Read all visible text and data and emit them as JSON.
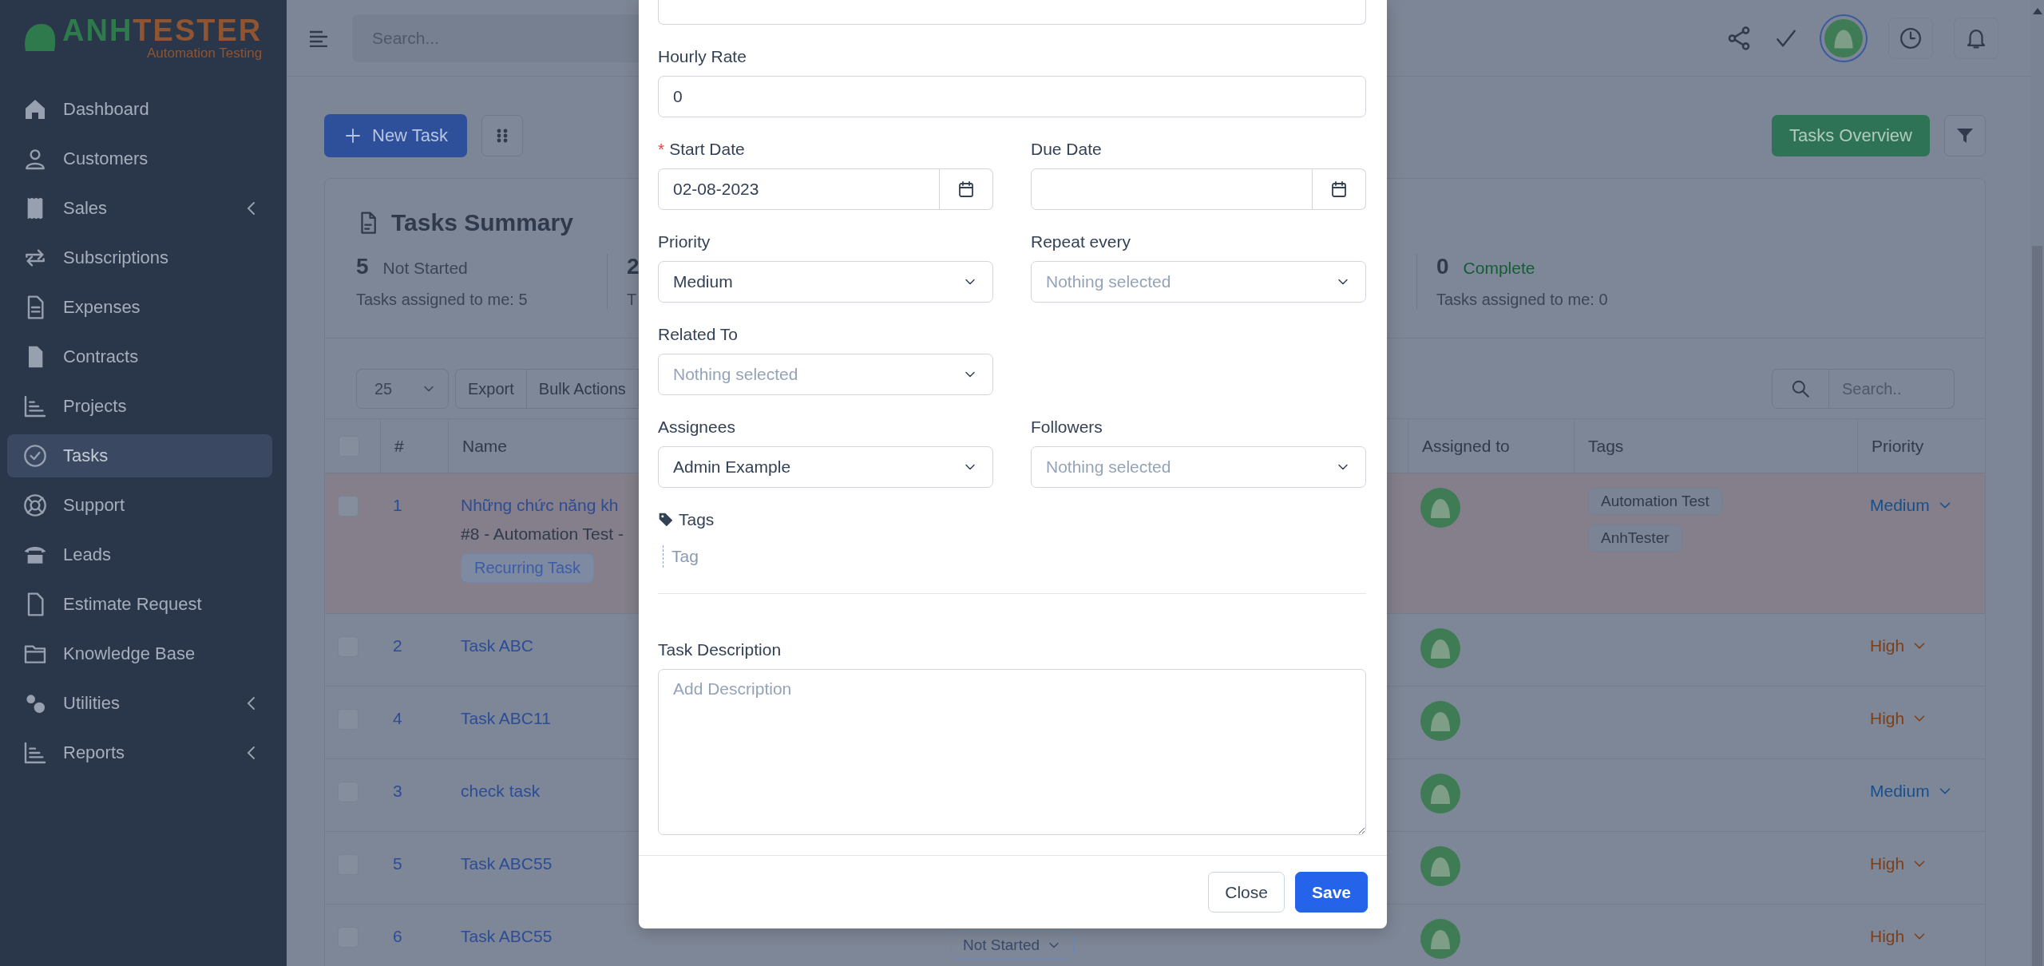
{
  "logo": {
    "name_start": "ANH",
    "name_end": "TESTER",
    "tagline": "Automation Testing"
  },
  "sidebar": {
    "items": [
      {
        "label": "Dashboard",
        "selected": false,
        "has_submenu": false
      },
      {
        "label": "Customers",
        "selected": false,
        "has_submenu": false
      },
      {
        "label": "Sales",
        "selected": false,
        "has_submenu": true
      },
      {
        "label": "Subscriptions",
        "selected": false,
        "has_submenu": false
      },
      {
        "label": "Expenses",
        "selected": false,
        "has_submenu": false
      },
      {
        "label": "Contracts",
        "selected": false,
        "has_submenu": false
      },
      {
        "label": "Projects",
        "selected": false,
        "has_submenu": false
      },
      {
        "label": "Tasks",
        "selected": true,
        "has_submenu": false
      },
      {
        "label": "Support",
        "selected": false,
        "has_submenu": false
      },
      {
        "label": "Leads",
        "selected": false,
        "has_submenu": false
      },
      {
        "label": "Estimate Request",
        "selected": false,
        "has_submenu": false
      },
      {
        "label": "Knowledge Base",
        "selected": false,
        "has_submenu": false
      },
      {
        "label": "Utilities",
        "selected": false,
        "has_submenu": true
      },
      {
        "label": "Reports",
        "selected": false,
        "has_submenu": true
      }
    ]
  },
  "header": {
    "search": {
      "placeholder": "Search..."
    }
  },
  "toolbar": {
    "new_button": "New Task",
    "overview_button": "Tasks Overview"
  },
  "summary": {
    "title": "Tasks Summary",
    "stats": [
      {
        "count": "5",
        "label": "Not Started",
        "note": "Tasks assigned to me: 5",
        "kind": "not_started"
      },
      {
        "count": "2",
        "note": "T"
      },
      {
        "count": "0",
        "label": "Complete",
        "note": "Tasks assigned to me: 0",
        "kind": "complete"
      }
    ]
  },
  "table": {
    "page_size": "25",
    "export_button": "Export",
    "bulk_button": "Bulk Actions",
    "search": {
      "placeholder": "Search.."
    },
    "all_checked": false,
    "columns": [
      "#",
      "Name",
      "Assigned to",
      "Tags",
      "Priority"
    ],
    "rows": [
      {
        "id": "1",
        "checked": false,
        "name": "Những chức năng kh",
        "subtitle": "#8 - Automation Test -",
        "badge": "Recurring Task",
        "highlighted": true,
        "tags": [
          "Automation Test",
          "AnhTester"
        ],
        "priority": {
          "label": "Medium",
          "kind": "medium"
        }
      },
      {
        "id": "2",
        "checked": false,
        "name": "Task ABC",
        "highlighted": false,
        "priority": {
          "label": "High",
          "kind": "high"
        }
      },
      {
        "id": "4",
        "checked": false,
        "name": "Task ABC11",
        "highlighted": false,
        "priority": {
          "label": "High",
          "kind": "high"
        }
      },
      {
        "id": "3",
        "checked": false,
        "name": "check task",
        "highlighted": false,
        "priority": {
          "label": "Medium",
          "kind": "medium"
        }
      },
      {
        "id": "5",
        "checked": false,
        "name": "Task ABC55",
        "highlighted": false,
        "priority": {
          "label": "High",
          "kind": "high"
        }
      },
      {
        "id": "6",
        "checked": false,
        "name": "Task ABC55",
        "status": "Not Started",
        "highlighted": false,
        "priority": {
          "label": "High",
          "kind": "high"
        }
      }
    ]
  },
  "modal": {
    "rows": [
      {
        "fields": [
          {
            "kind": "partial_text"
          }
        ]
      },
      {
        "fields": [
          {
            "kind": "text",
            "label": "Hourly Rate",
            "value": "0"
          }
        ]
      },
      {
        "fields": [
          {
            "kind": "date",
            "label": "Start Date",
            "required_mark": "*",
            "value": "02-08-2023"
          },
          {
            "kind": "date",
            "label": "Due Date"
          }
        ]
      },
      {
        "fields": [
          {
            "kind": "select",
            "label": "Priority",
            "value": "Medium"
          },
          {
            "kind": "select",
            "label": "Repeat every",
            "placeholder": "Nothing selected"
          }
        ]
      },
      {
        "fields": [
          {
            "kind": "select",
            "label": "Related To",
            "placeholder": "Nothing selected"
          }
        ]
      },
      {
        "fields": [
          {
            "kind": "select",
            "label": "Assignees",
            "value": "Admin Example"
          },
          {
            "kind": "select",
            "label": "Followers",
            "placeholder": "Nothing selected"
          }
        ]
      },
      {
        "fields": [
          {
            "kind": "tags",
            "label": "Tags",
            "placeholder": "Tag"
          }
        ]
      },
      {
        "fields": [
          {
            "kind": "textarea",
            "label": "Task Description",
            "placeholder": "Add Description"
          }
        ]
      }
    ],
    "buttons": [
      {
        "label": "Close",
        "kind": "secondary"
      },
      {
        "label": "Save",
        "kind": "primary"
      }
    ]
  }
}
